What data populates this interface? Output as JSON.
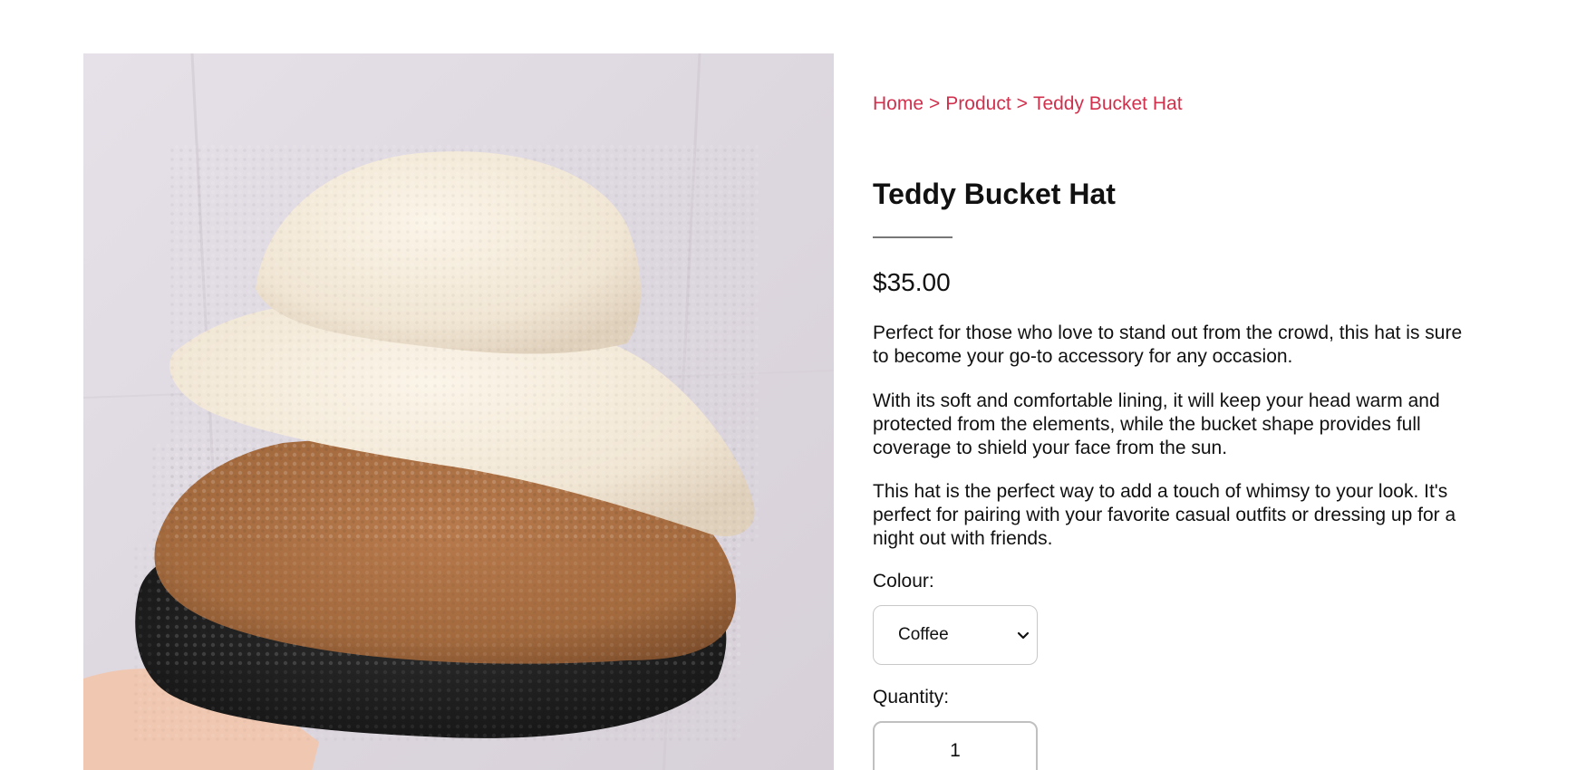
{
  "breadcrumb": {
    "home": "Home",
    "separator_1": ">",
    "product": "Product",
    "separator_2": ">",
    "current": "Teddy Bucket Hat"
  },
  "product": {
    "title": "Teddy Bucket Hat",
    "price": "$35.00",
    "image_icon": "product-photo",
    "description": [
      "Perfect for those who love to stand out from the crowd, this hat is sure to become your go-to accessory for any occasion.",
      "With its soft and comfortable lining, it will keep your head warm and protected from the elements, while the bucket shape provides full coverage to shield your face from the sun.",
      "This hat is the perfect way to add a touch of whimsy to your look. It's perfect for pairing with your favorite casual outfits or dressing up for a night out with friends."
    ]
  },
  "options": {
    "colour_label": "Colour:",
    "colour_selected": "Coffee",
    "quantity_label": "Quantity:",
    "quantity_value": "1"
  },
  "colors": {
    "accent": "#d1304d",
    "text": "#111111",
    "rule": "#777777",
    "input_border": "#c8c8c8"
  }
}
